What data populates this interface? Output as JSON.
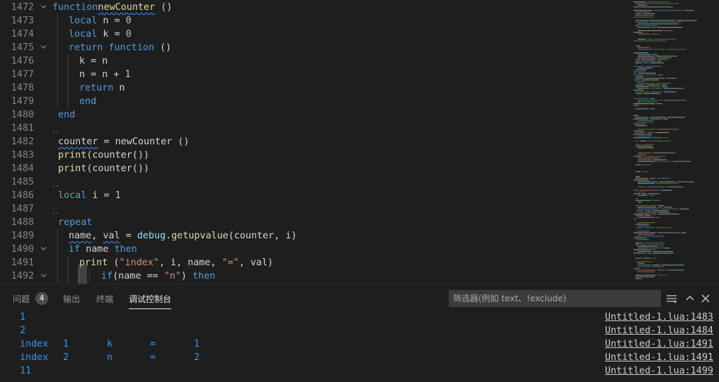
{
  "editor": {
    "line_numbers": [
      "1472",
      "1473",
      "1474",
      "1475",
      "1476",
      "1477",
      "1478",
      "1479",
      "1480",
      "1481",
      "1482",
      "1483",
      "1484",
      "1485",
      "1486",
      "1487",
      "1488",
      "1489",
      "1490",
      "1491",
      "1492"
    ],
    "fold_icon": "chevron-down-icon"
  },
  "code": {
    "l1472": [
      "function",
      "newCounter",
      " ()"
    ],
    "l1473": [
      "local",
      " n = ",
      "0"
    ],
    "l1474": [
      "local",
      " k = ",
      "0"
    ],
    "l1475": [
      "return",
      " ",
      "function",
      " ()"
    ],
    "l1476": [
      "k = n"
    ],
    "l1477": [
      "n = n + ",
      "1"
    ],
    "l1478": [
      "return",
      " n"
    ],
    "l1479": [
      "end"
    ],
    "l1480": [
      "end"
    ],
    "l1482": [
      "counter",
      " = newCounter ()"
    ],
    "l1483": [
      "print",
      "(counter())"
    ],
    "l1484": [
      "print",
      "(counter())"
    ],
    "l1486": [
      "local",
      " i = ",
      "1"
    ],
    "l1488": [
      "repeat"
    ],
    "l1489": [
      "name",
      ", ",
      "val",
      " = ",
      "debug",
      ".",
      "getupvalue",
      "(counter, i)"
    ],
    "l1490": [
      "if",
      " name ",
      "then"
    ],
    "l1491": [
      "print",
      " (",
      "\"index\"",
      ", i, name, ",
      "\"=\"",
      ", val)"
    ],
    "l1492": [
      "if",
      "(name == ",
      "\"n\"",
      ") ",
      "then"
    ]
  },
  "panel": {
    "tabs": [
      "问题",
      "输出",
      "终端",
      "调试控制台"
    ],
    "problems_count": "4",
    "filter_placeholder": "筛选器(例如 text、!exclude)",
    "icons": [
      "word-wrap-icon",
      "chevron-up-icon",
      "close-icon"
    ]
  },
  "output": [
    {
      "cols": [
        "1"
      ],
      "source": "Untitled-1.lua:1483"
    },
    {
      "cols": [
        "2"
      ],
      "source": "Untitled-1.lua:1484"
    },
    {
      "cols": [
        "index",
        "1",
        "k",
        "=",
        "1"
      ],
      "source": "Untitled-1.lua:1491"
    },
    {
      "cols": [
        "index",
        "2",
        "n",
        "=",
        "2"
      ],
      "source": "Untitled-1.lua:1491"
    },
    {
      "cols": [
        "11"
      ],
      "source": "Untitled-1.lua:1499"
    }
  ],
  "colors": {
    "background": "#1e1e1e",
    "keyword": "#569cd6",
    "function": "#dcdcaa",
    "number": "#b5cea8",
    "string": "#ce9178",
    "output_text": "#3794ff"
  }
}
